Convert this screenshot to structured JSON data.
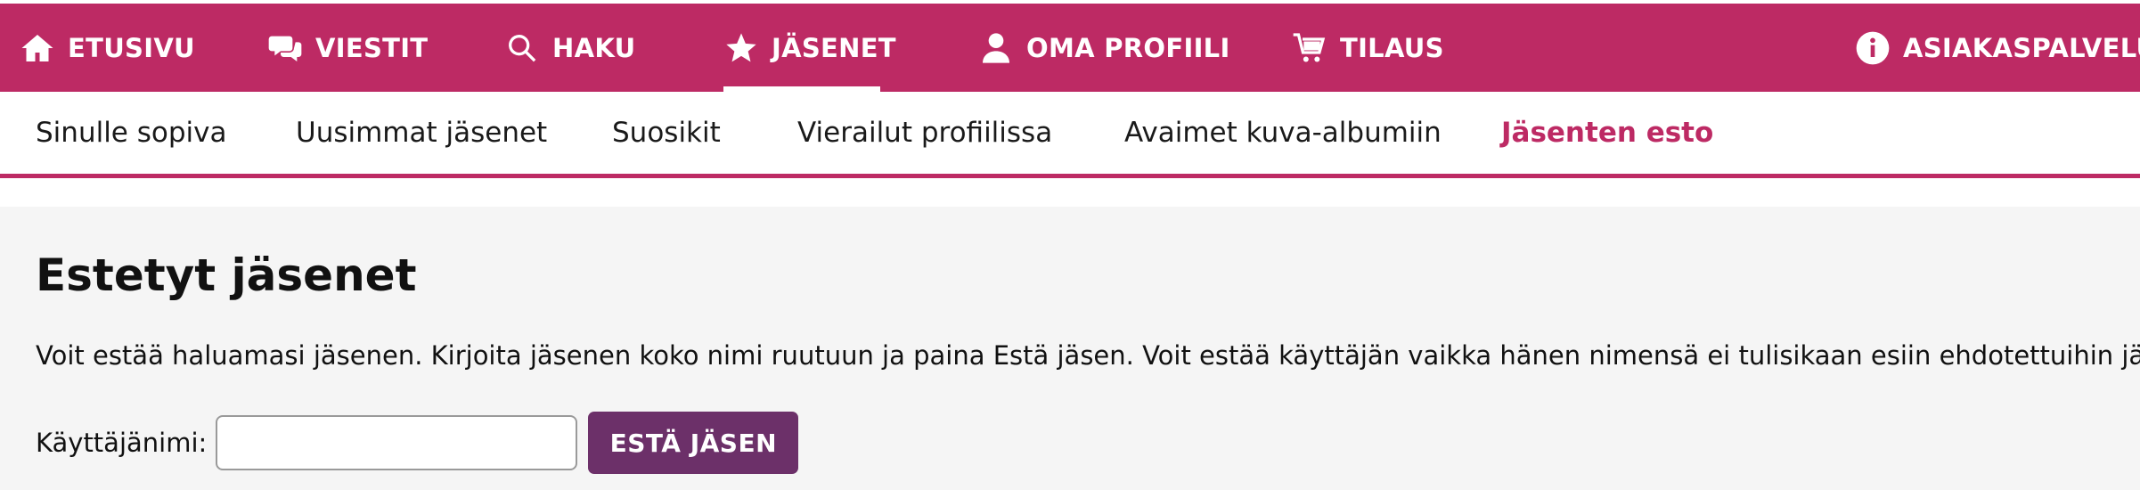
{
  "top_nav": {
    "items": [
      {
        "label": "ETUSIVU",
        "icon": "home-icon"
      },
      {
        "label": "VIESTIT",
        "icon": "chat-icon"
      },
      {
        "label": "HAKU",
        "icon": "search-icon"
      },
      {
        "label": "JÄSENET",
        "icon": "star-icon",
        "active": true
      },
      {
        "label": "OMA PROFIILI",
        "icon": "user-icon"
      },
      {
        "label": "TILAUS",
        "icon": "cart-icon"
      }
    ],
    "support": {
      "label": "ASIAKASPALVELU",
      "icon": "info-icon"
    }
  },
  "sub_nav": {
    "items": [
      {
        "label": "Sinulle sopiva"
      },
      {
        "label": "Uusimmat jäsenet"
      },
      {
        "label": "Suosikit"
      },
      {
        "label": "Vierailut profiilissa"
      },
      {
        "label": "Avaimet kuva-albumiin"
      },
      {
        "label": "Jäsenten esto",
        "active": true
      }
    ]
  },
  "main": {
    "title": "Estetyt jäsenet",
    "description": "Voit estää haluamasi jäsenen. Kirjoita jäsenen koko nimi ruutuun ja paina Estä jäsen. Voit estää käyttäjän vaikka hänen nimensä ei tulisikaan esiin ehdotettuihin jäseniin.",
    "form": {
      "username_label": "Käyttäjänimi:",
      "username_value": "",
      "button_label": "ESTÄ JÄSEN"
    }
  },
  "colors": {
    "brand": "#bd2a64",
    "button": "#6c3069",
    "content_bg": "#f5f5f5"
  }
}
